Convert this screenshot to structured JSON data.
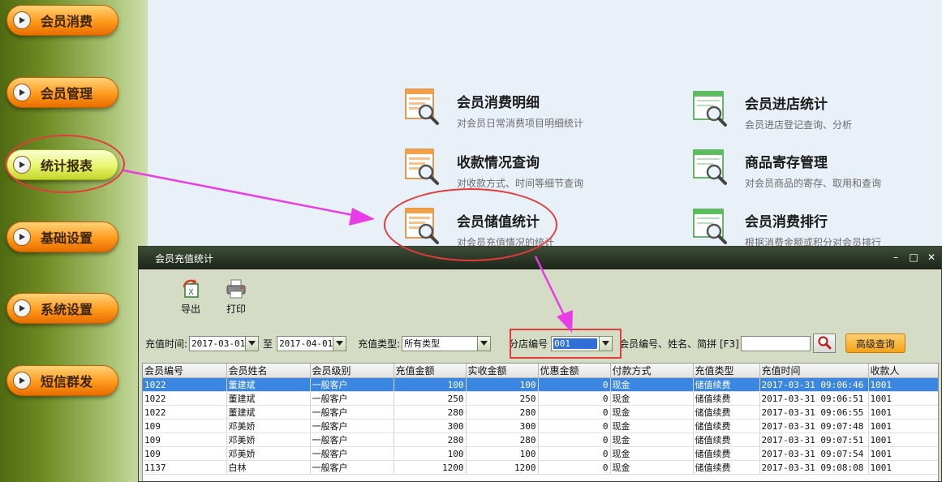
{
  "sidebar": {
    "items": [
      {
        "label": "会员消费",
        "active": false
      },
      {
        "label": "会员管理",
        "active": false
      },
      {
        "label": "统计报表",
        "active": true
      },
      {
        "label": "基础设置",
        "active": false
      },
      {
        "label": "系统设置",
        "active": false
      },
      {
        "label": "短信群发",
        "active": false
      }
    ]
  },
  "reports": {
    "items": [
      {
        "title": "会员消费明细",
        "desc": "对会员日常消费项目明细统计",
        "icon": "report-list-icon"
      },
      {
        "title": "会员进店统计",
        "desc": "会员进店登记查询、分析",
        "icon": "report-window-icon"
      },
      {
        "title": "收款情况查询",
        "desc": "对收款方式、时间等细节查询",
        "icon": "report-list-icon"
      },
      {
        "title": "商品寄存管理",
        "desc": "对会员商品的寄存、取用和查询",
        "icon": "report-window-icon"
      },
      {
        "title": "会员储值统计",
        "desc": "对会员充值情况的统计",
        "icon": "report-list-icon"
      },
      {
        "title": "会员消费排行",
        "desc": "根据消费金额或积分对会员排行",
        "icon": "report-window-icon"
      }
    ]
  },
  "dialog": {
    "title": "会员充值统计",
    "controls": {
      "minimize": "–",
      "maximize": "□",
      "close": "✕"
    },
    "toolbar": {
      "export_label": "导出",
      "print_label": "打印"
    },
    "filters": {
      "date_label": "充值时间:",
      "date_from": "2017-03-01",
      "date_to_label": "至",
      "date_to": "2017-04-01",
      "type_label": "充值类型:",
      "type_value": "所有类型",
      "branch_label": "分店编号",
      "branch_value": "001",
      "search_label": "会员编号、姓名、简拼 [F3]",
      "search_value": "",
      "advanced_label": "高级查询"
    },
    "table": {
      "columns": [
        "会员编号",
        "会员姓名",
        "会员级别",
        "充值金额",
        "实收金额",
        "优惠金额",
        "付款方式",
        "充值类型",
        "充值时间",
        "收款人"
      ],
      "rows": [
        [
          "1022",
          "董建斌",
          "一般客户",
          "100",
          "100",
          "0",
          "现金",
          "储值续费",
          "2017-03-31 09:06:46",
          "1001"
        ],
        [
          "1022",
          "董建斌",
          "一般客户",
          "250",
          "250",
          "0",
          "现金",
          "储值续费",
          "2017-03-31 09:06:51",
          "1001"
        ],
        [
          "1022",
          "董建斌",
          "一般客户",
          "280",
          "280",
          "0",
          "现金",
          "储值续费",
          "2017-03-31 09:06:55",
          "1001"
        ],
        [
          "109",
          "邓美娇",
          "一般客户",
          "300",
          "300",
          "0",
          "现金",
          "储值续费",
          "2017-03-31 09:07:48",
          "1001"
        ],
        [
          "109",
          "邓美娇",
          "一般客户",
          "280",
          "280",
          "0",
          "现金",
          "储值续费",
          "2017-03-31 09:07:51",
          "1001"
        ],
        [
          "109",
          "邓美娇",
          "一般客户",
          "100",
          "100",
          "0",
          "现金",
          "储值续费",
          "2017-03-31 09:07:54",
          "1001"
        ],
        [
          "1137",
          "白林",
          "一般客户",
          "1200",
          "1200",
          "0",
          "现金",
          "储值续费",
          "2017-03-31 09:08:08",
          "1001"
        ]
      ],
      "selected_row": 0
    }
  },
  "annotation_colors": {
    "highlight": "#e53b3b",
    "arrow": "#e93ce8"
  }
}
